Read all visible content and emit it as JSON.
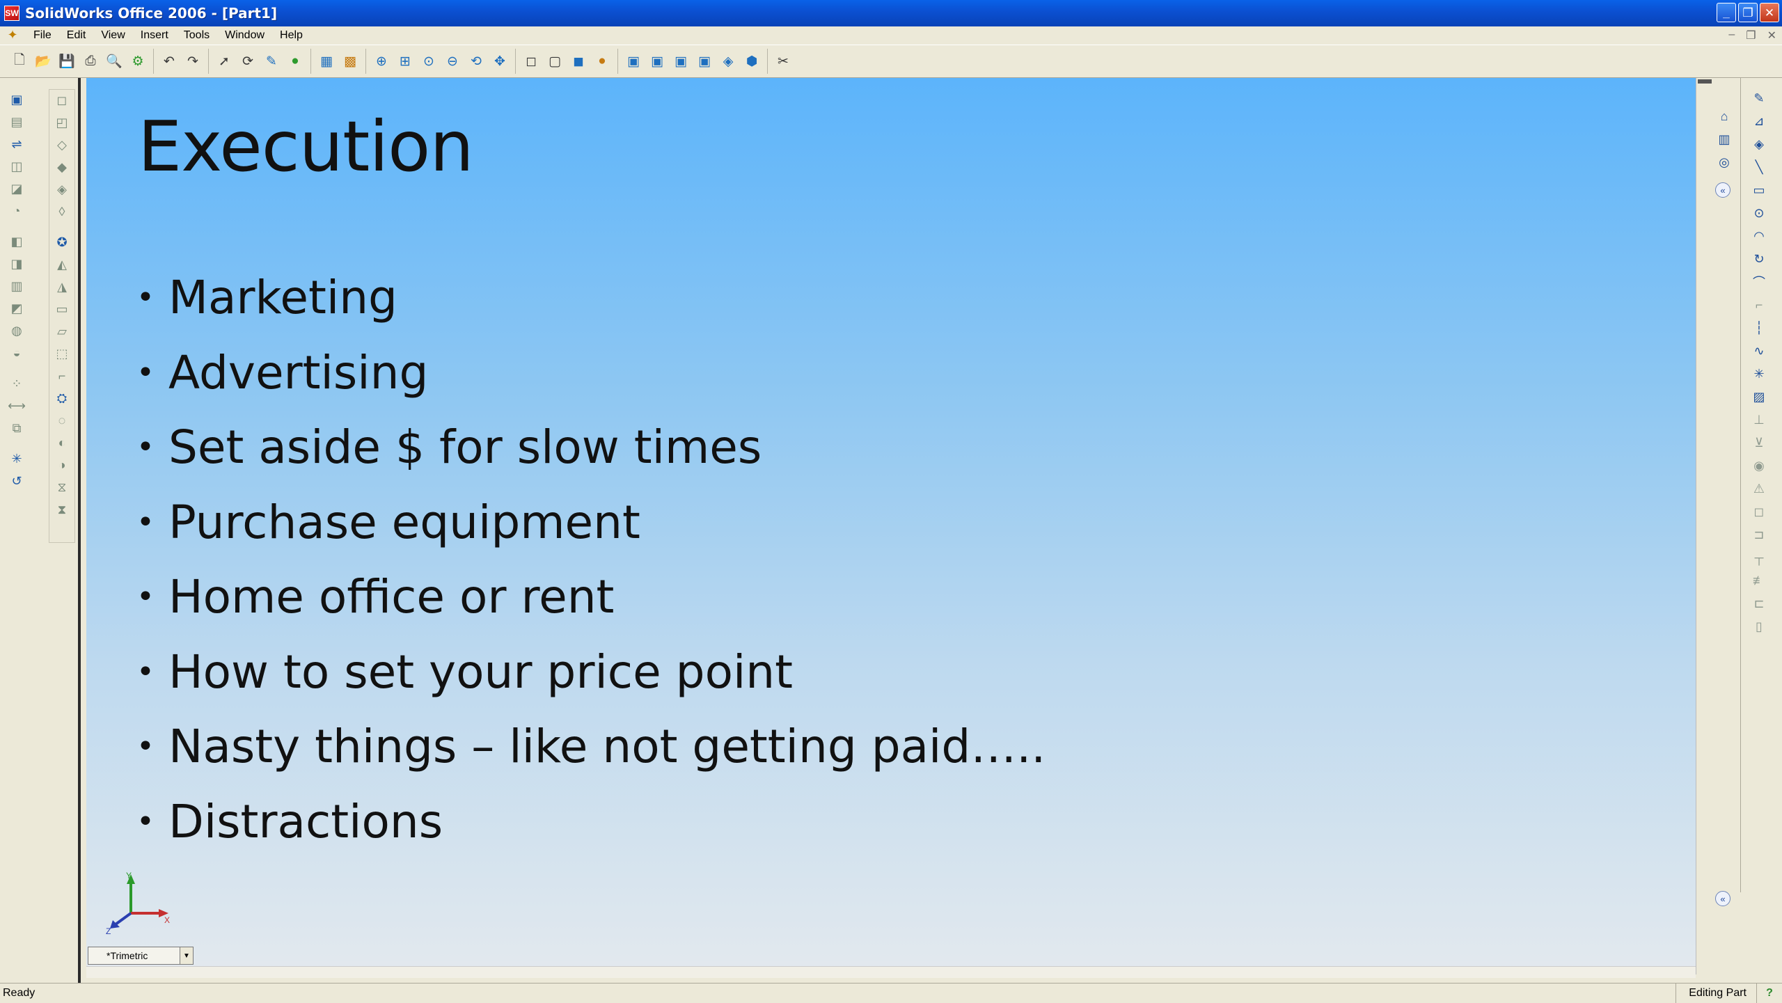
{
  "window": {
    "title": "SolidWorks Office 2006 - [Part1]",
    "app_icon": "SW",
    "controls": {
      "minimize": "_",
      "restore": "❐",
      "close": "✕"
    }
  },
  "menu": {
    "items": [
      "File",
      "Edit",
      "View",
      "Insert",
      "Tools",
      "Window",
      "Help"
    ],
    "mdi": {
      "minimize": "–",
      "restore": "❐",
      "close": "✕"
    }
  },
  "toolbar": {
    "groups": [
      [
        "new-icon",
        "open-icon",
        "save-icon",
        "print-icon",
        "print-preview-icon",
        "options-icon"
      ],
      [
        "undo-icon",
        "redo-icon"
      ],
      [
        "select-icon",
        "rebuild-icon",
        "sketch-icon",
        "traffic-light-icon"
      ],
      [
        "grid-icon",
        "color-icon"
      ],
      [
        "zoom-fit-icon",
        "zoom-area-icon",
        "zoom-in-icon",
        "zoom-out-icon",
        "rotate-icon",
        "pan-icon"
      ],
      [
        "wireframe-icon",
        "hidden-lines-icon",
        "shaded-icon",
        "shadows-icon"
      ],
      [
        "front-view-icon",
        "back-view-icon",
        "left-view-icon",
        "right-view-icon",
        "top-view-icon",
        "isometric-icon"
      ]
    ]
  },
  "slide": {
    "title": "Execution",
    "bullets": [
      "Marketing",
      "Advertising",
      "Set aside $ for slow times",
      "Purchase equipment",
      "Home office or rent",
      "How to set your price point",
      "Nasty things – like not getting paid…..",
      "Distractions"
    ],
    "bullet_char": "•"
  },
  "view": {
    "orientation": "*Trimetric",
    "triad_labels": {
      "x": "X",
      "y": "Y",
      "z": "Z"
    }
  },
  "status": {
    "left": "Ready",
    "right": "Editing Part",
    "help": "?"
  },
  "colors": {
    "titlebar": "#0b4fd0",
    "viewport_top": "#5cb4fb",
    "viewport_bottom": "#e3e9ee",
    "chrome": "#ece9d8"
  }
}
